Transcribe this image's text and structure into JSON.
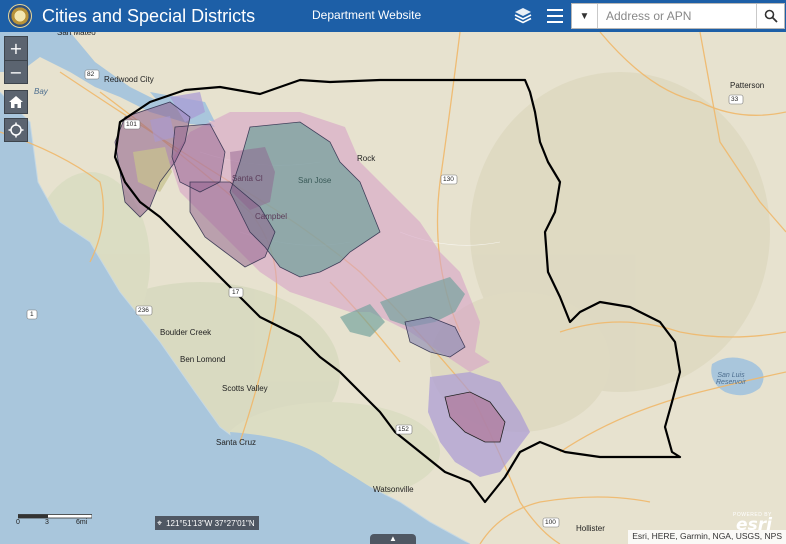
{
  "header": {
    "title": "Cities and Special Districts",
    "dept_link": "Department Website",
    "bg_color": "#1d5fa7"
  },
  "search": {
    "placeholder": "Address or APN",
    "value": ""
  },
  "icons": {
    "layers": "layers-icon",
    "menu": "menu-icon",
    "dropdown": "chevron-down-icon",
    "search": "search-icon",
    "home": "home-icon",
    "locate": "locate-icon"
  },
  "controls": {
    "zoom_in": "+",
    "zoom_out": "−"
  },
  "map_labels": [
    {
      "id": "san-mateo",
      "text": "San Mateo"
    },
    {
      "id": "redwood-city",
      "text": "Redwood City"
    },
    {
      "id": "bay",
      "text": "Bay"
    },
    {
      "id": "patterson",
      "text": "Patterson"
    },
    {
      "id": "rock",
      "text": "Rock"
    },
    {
      "id": "san-jose",
      "text": "San Jose"
    },
    {
      "id": "santa-clara",
      "text": "Santa Cl"
    },
    {
      "id": "campbell",
      "text": "Campbel"
    },
    {
      "id": "boulder-creek",
      "text": "Boulder Creek"
    },
    {
      "id": "ben-lomond",
      "text": "Ben Lomond"
    },
    {
      "id": "scotts-valley",
      "text": "Scotts Valley"
    },
    {
      "id": "santa-cruz",
      "text": "Santa Cruz"
    },
    {
      "id": "watsonville",
      "text": "Watsonville"
    },
    {
      "id": "hollister",
      "text": "Hollister"
    },
    {
      "id": "san-luis",
      "text": "San Luis\nReservoir"
    }
  ],
  "road_shields": [
    "82",
    "101",
    "33",
    "130",
    "17",
    "236",
    "1",
    "152",
    "100"
  ],
  "scalebar": {
    "labels": [
      "0",
      "3",
      "6mi"
    ]
  },
  "coordinates": "121°51'13\"W 37°27'01\"N",
  "attribution": "Esri, HERE, Garmin, NGA, USGS, NPS",
  "esri": {
    "powered": "POWERED BY",
    "word": "esri"
  },
  "colors": {
    "land": "#e9e4d4",
    "water": "#a9c6dc",
    "county_boundary": "#000000",
    "district_pink": "#d7a3c7",
    "city_teal": "#6f9f9b",
    "city_purple": "#8e5d8b",
    "district_lavender": "#a99ad4",
    "city_olive": "#c7c28f"
  }
}
